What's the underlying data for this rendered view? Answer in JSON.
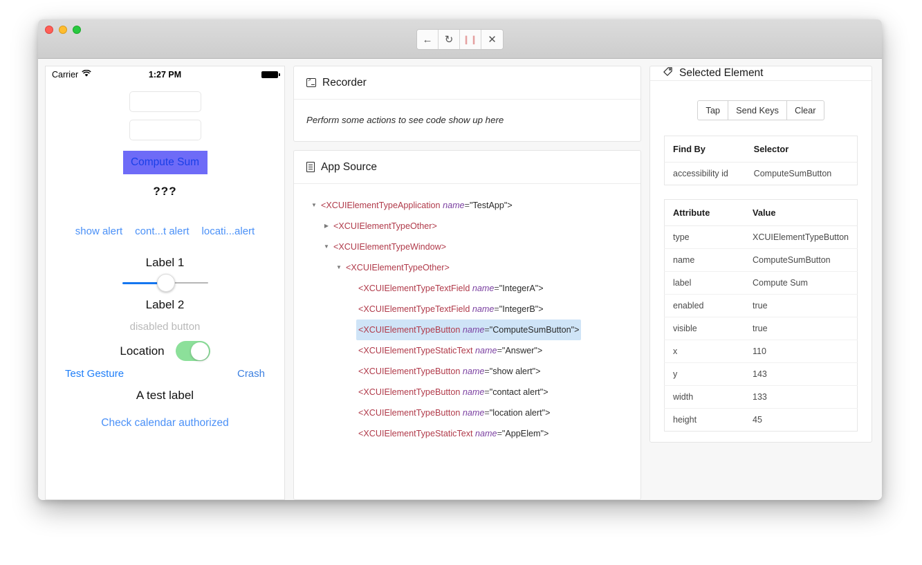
{
  "window": {
    "toolbar": [
      {
        "name": "back-button",
        "glyph": "←"
      },
      {
        "name": "refresh-button",
        "glyph": "↻"
      },
      {
        "name": "pause-button",
        "glyph": "❙❙"
      },
      {
        "name": "close-button",
        "glyph": "✕"
      }
    ]
  },
  "phone": {
    "status_bar": {
      "carrier": "Carrier",
      "time": "1:27 PM"
    },
    "text_field_a_value": "",
    "text_field_b_value": "",
    "compute_button_label": "Compute Sum",
    "answer_text": "???",
    "alert_buttons": [
      "show alert",
      "cont...t alert",
      "locati...alert"
    ],
    "label_1": "Label 1",
    "label_2": "Label 2",
    "slider_value": 50,
    "disabled_button_label": "disabled button",
    "location_label": "Location",
    "location_toggle_on": true,
    "test_gesture_label": "Test Gesture",
    "crash_label": "Crash",
    "test_label": "A test label",
    "check_calendar_label": "Check calendar authorized"
  },
  "recorder": {
    "title": "Recorder",
    "icon": "terminal-icon",
    "hint": "Perform some actions to see code show up here"
  },
  "app_source": {
    "title": "App Source",
    "icon": "document-icon",
    "tree": [
      {
        "indent": 0,
        "caret": "down",
        "tag": "<XCUIElementTypeApplication",
        "attr": "name",
        "value": "\"TestApp\"",
        "close": ">",
        "selected": false
      },
      {
        "indent": 1,
        "caret": "right",
        "tag": "<XCUIElementTypeOther>",
        "attr": "",
        "value": "",
        "close": "",
        "selected": false
      },
      {
        "indent": 1,
        "caret": "down",
        "tag": "<XCUIElementTypeWindow>",
        "attr": "",
        "value": "",
        "close": "",
        "selected": false
      },
      {
        "indent": 2,
        "caret": "down",
        "tag": "<XCUIElementTypeOther>",
        "attr": "",
        "value": "",
        "close": "",
        "selected": false
      },
      {
        "indent": 3,
        "caret": "none",
        "tag": "<XCUIElementTypeTextField",
        "attr": "name",
        "value": "\"IntegerA\"",
        "close": ">",
        "selected": false
      },
      {
        "indent": 3,
        "caret": "none",
        "tag": "<XCUIElementTypeTextField",
        "attr": "name",
        "value": "\"IntegerB\"",
        "close": ">",
        "selected": false
      },
      {
        "indent": 3,
        "caret": "none",
        "tag": "<XCUIElementTypeButton",
        "attr": "name",
        "value": "\"ComputeSumButton\"",
        "close": ">",
        "selected": true
      },
      {
        "indent": 3,
        "caret": "none",
        "tag": "<XCUIElementTypeStaticText",
        "attr": "name",
        "value": "\"Answer\"",
        "close": ">",
        "selected": false
      },
      {
        "indent": 3,
        "caret": "none",
        "tag": "<XCUIElementTypeButton",
        "attr": "name",
        "value": "\"show alert\"",
        "close": ">",
        "selected": false
      },
      {
        "indent": 3,
        "caret": "none",
        "tag": "<XCUIElementTypeButton",
        "attr": "name",
        "value": "\"contact alert\"",
        "close": ">",
        "selected": false
      },
      {
        "indent": 3,
        "caret": "none",
        "tag": "<XCUIElementTypeButton",
        "attr": "name",
        "value": "\"location alert\"",
        "close": ">",
        "selected": false
      },
      {
        "indent": 3,
        "caret": "none",
        "tag": "<XCUIElementTypeStaticText",
        "attr": "name",
        "value": "\"AppElem\"",
        "close": ">",
        "selected": false
      }
    ]
  },
  "selected_element": {
    "title": "Selected Element",
    "icon": "tag-icon",
    "actions": [
      "Tap",
      "Send Keys",
      "Clear"
    ],
    "locator_table": {
      "headers": [
        "Find By",
        "Selector"
      ],
      "rows": [
        [
          "accessibility id",
          "ComputeSumButton"
        ]
      ]
    },
    "attribute_table": {
      "headers": [
        "Attribute",
        "Value"
      ],
      "rows": [
        [
          "type",
          "XCUIElementTypeButton"
        ],
        [
          "name",
          "ComputeSumButton"
        ],
        [
          "label",
          "Compute Sum"
        ],
        [
          "enabled",
          "true"
        ],
        [
          "visible",
          "true"
        ],
        [
          "x",
          "110"
        ],
        [
          "y",
          "143"
        ],
        [
          "width",
          "133"
        ],
        [
          "height",
          "45"
        ]
      ]
    }
  },
  "colors": {
    "accent_blue": "#4a90f7",
    "selected_button": "#6e6bf7",
    "toggle_on": "#8ce09a",
    "tree_selection": "#cfe4f7",
    "tag_color": "#b03a4a",
    "attr_color": "#7a3fa0"
  }
}
